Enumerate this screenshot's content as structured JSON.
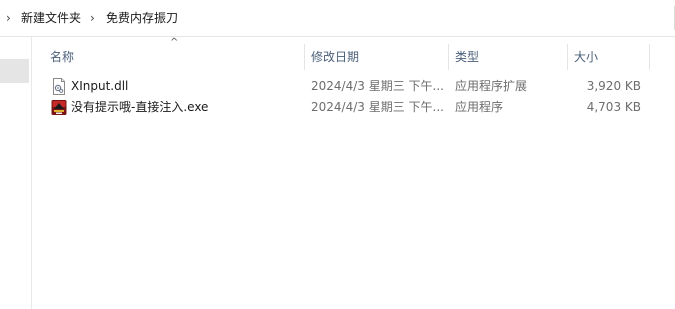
{
  "breadcrumb": {
    "items": [
      "新建文件夹",
      "免费内存振刀"
    ]
  },
  "columns": {
    "name": "名称",
    "date": "修改日期",
    "type": "类型",
    "size": "大小"
  },
  "files": [
    {
      "name": "XInput.dll",
      "date": "2024/4/3 星期三 下午...",
      "type": "应用程序扩展",
      "size": "3,920 KB",
      "icon": "dll-file-icon"
    },
    {
      "name": "没有提示哦-直接注入.exe",
      "date": "2024/4/3 星期三 下午...",
      "type": "应用程序",
      "size": "4,703 KB",
      "icon": "exe-app-icon"
    }
  ]
}
